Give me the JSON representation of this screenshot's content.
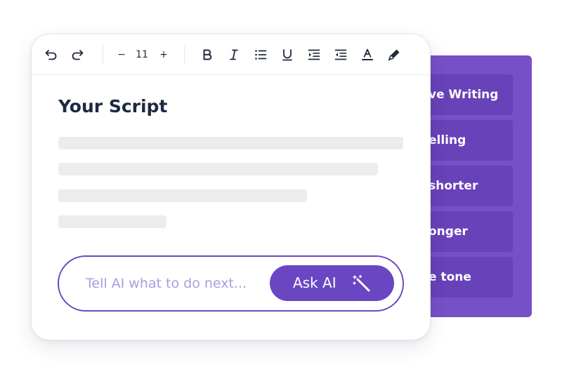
{
  "side_panel": {
    "items": [
      "ve Writing",
      "elling",
      "shorter",
      "onger",
      "e tone"
    ]
  },
  "toolbar": {
    "font_size": "11",
    "decrease_label": "−",
    "increase_label": "+"
  },
  "editor": {
    "title": "Your Script"
  },
  "prompt": {
    "placeholder": "Tell AI what to do next...",
    "button_label": "Ask AI"
  },
  "colors": {
    "accent": "#6a46c3",
    "panel": "#7650c6",
    "panel_item": "#6842b8",
    "title": "#1e2a40",
    "placeholder_line": "#ececec"
  },
  "icons": [
    "undo-icon",
    "redo-icon",
    "bold-icon",
    "italic-icon",
    "bullet-list-icon",
    "underline-icon",
    "indent-icon",
    "outdent-icon",
    "text-color-icon",
    "highlighter-icon",
    "magic-wand-icon"
  ]
}
